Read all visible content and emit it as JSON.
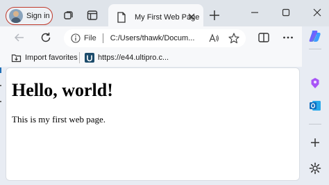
{
  "tabstrip": {
    "signin_label": "Sign in",
    "tab_title": "My First Web Page"
  },
  "address_bar": {
    "scheme_label": "File",
    "url": "C:/Users/thawk/Docum..."
  },
  "favorites": {
    "items": [
      {
        "label": "Import favorites",
        "icon": "import-favorites-icon"
      },
      {
        "label": "https://e44.ultipro.c...",
        "icon": "ultipro-icon"
      }
    ]
  },
  "page": {
    "heading": "Hello, world!",
    "paragraph": "This is my first web page."
  },
  "sidebar": {
    "icons": [
      "copilot-icon",
      "shopping-icon",
      "outlook-icon",
      "add-icon",
      "settings-icon"
    ]
  },
  "colors": {
    "signin_border": "#c0392b",
    "chrome_background": "#dfe4ea",
    "active_surface": "#f7f8fa",
    "page_background": "#ffffff"
  }
}
